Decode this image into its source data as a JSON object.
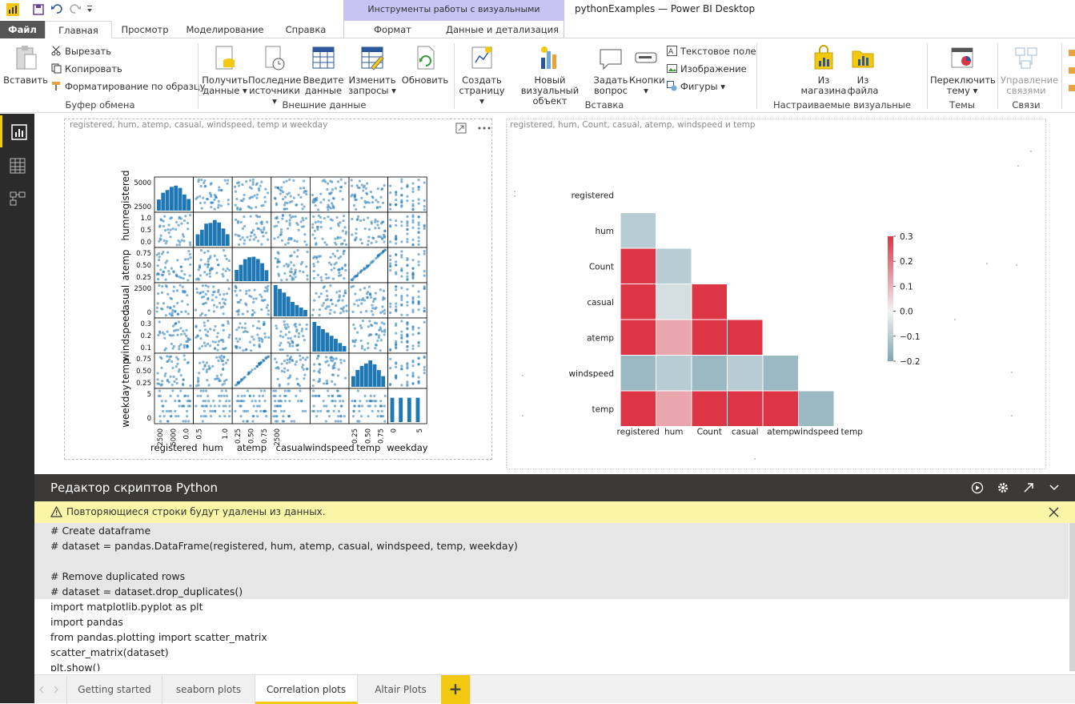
{
  "window": {
    "title": "pythonExamples — Power BI Desktop",
    "context_tools": "Инструменты работы с визуальными элементами"
  },
  "tabs": {
    "file": "Файл",
    "home": "Главная",
    "view": "Просмотр",
    "modeling": "Моделирование",
    "help": "Справка",
    "format": "Формат",
    "data_drill": "Данные и детализация"
  },
  "ribbon": {
    "paste": "Вставить",
    "cut": "Вырезать",
    "copy": "Копировать",
    "format_painter": "Форматирование по образцу",
    "clipboard_group": "Буфер обмена",
    "get_data_1": "Получить",
    "get_data_2": "данные ▾",
    "recent_1": "Последние",
    "recent_2": "источники ▾",
    "enter_1": "Введите",
    "enter_2": "данные",
    "edit_1": "Изменить",
    "edit_2": "запросы ▾",
    "refresh": "Обновить",
    "external_group": "Внешние данные",
    "newpage_1": "Создать",
    "newpage_2": "страницу ▾",
    "newvisual_1": "Новый визуальный",
    "newvisual_2": "объект",
    "ask_1": "Задать",
    "ask_2": "вопрос",
    "buttons_1": "Кнопки",
    "buttons_2": "▾",
    "textbox": "Текстовое поле",
    "image": "Изображение",
    "shapes": "Фигуры ▾",
    "insert_group": "Вставка",
    "store_1": "Из",
    "store_2": "магазина",
    "file_1": "Из",
    "file_2": "файла",
    "custom_group": "Настраиваемые визуальные элементы",
    "theme_1": "Переключить",
    "theme_2": "тему ▾",
    "themes_group": "Темы",
    "rel_1": "Управление",
    "rel_2": "связями",
    "rel_group": "Связи"
  },
  "visuals": {
    "left_title": "registered, hum, atemp, casual, windspeed, temp и weekday",
    "right_title": "registered, hum, Count, casual, atemp, windspeed и temp"
  },
  "chart_data": [
    {
      "type": "scatter",
      "variables": [
        "registered",
        "hum",
        "atemp",
        "casual",
        "windspeed",
        "temp",
        "weekday"
      ],
      "y_ticks": [
        [
          "5000",
          "2500"
        ],
        [
          "1.0",
          "0.5",
          "0.0"
        ],
        [
          "0.75",
          "0.50",
          "0.25"
        ],
        [
          "2500",
          "0"
        ],
        [
          "0.3",
          "0.2",
          "0.1"
        ],
        [
          "0.75",
          "0.50",
          "0.25"
        ],
        [
          "5",
          "0"
        ]
      ],
      "x_ticks": [
        [
          "2500",
          "5000",
          "0.0"
        ],
        [
          "0.5",
          "1.0"
        ],
        [
          "0.25",
          "0.50",
          "0.75"
        ],
        [
          "2500"
        ],
        [],
        [
          "0.25",
          "0.50",
          "0.75"
        ],
        [
          "0",
          "5"
        ]
      ]
    },
    {
      "type": "heatmap",
      "row_labels": [
        "registered",
        "hum",
        "Count",
        "casual",
        "atemp",
        "windspeed",
        "temp"
      ],
      "col_labels": [
        "registered",
        "hum",
        "Count",
        "casual",
        "atemp",
        "windspeed",
        "temp"
      ],
      "values": [
        [
          -0.1
        ],
        [
          0.3,
          -0.1
        ],
        [
          0.3,
          -0.05,
          0.3
        ],
        [
          0.3,
          0.12,
          0.3,
          0.3
        ],
        [
          -0.15,
          -0.1,
          -0.15,
          -0.1,
          -0.15
        ],
        [
          0.3,
          0.12,
          0.3,
          0.3,
          0.3,
          -0.15
        ]
      ],
      "colorbar_ticks": [
        "0.3",
        "0.2",
        "0.1",
        "0.0",
        "−0.1",
        "−0.2"
      ],
      "vmin": -0.2,
      "vmax": 0.3,
      "colors": {
        "positive": "#dc3545",
        "negative": "#7ea6b3",
        "neutral": "#f2f2f2"
      }
    }
  ],
  "editor": {
    "title": "Редактор скриптов Python",
    "warning": "Повторяющиеся строки будут удалены из данных.",
    "code_lines": [
      "# Create dataframe",
      "# dataset = pandas.DataFrame(registered, hum, atemp, casual, windspeed, temp, weekday)",
      "",
      "# Remove duplicated rows",
      "# dataset = dataset.drop_duplicates()",
      "import matplotlib.pyplot as plt",
      "import pandas",
      "from pandas.plotting import scatter_matrix",
      "scatter_matrix(dataset)",
      "plt.show()"
    ]
  },
  "pages": {
    "tabs": [
      "Getting started",
      "seaborn plots",
      "Correlation plots",
      "Altair Plots"
    ],
    "active": "Correlation plots",
    "add": "+"
  }
}
